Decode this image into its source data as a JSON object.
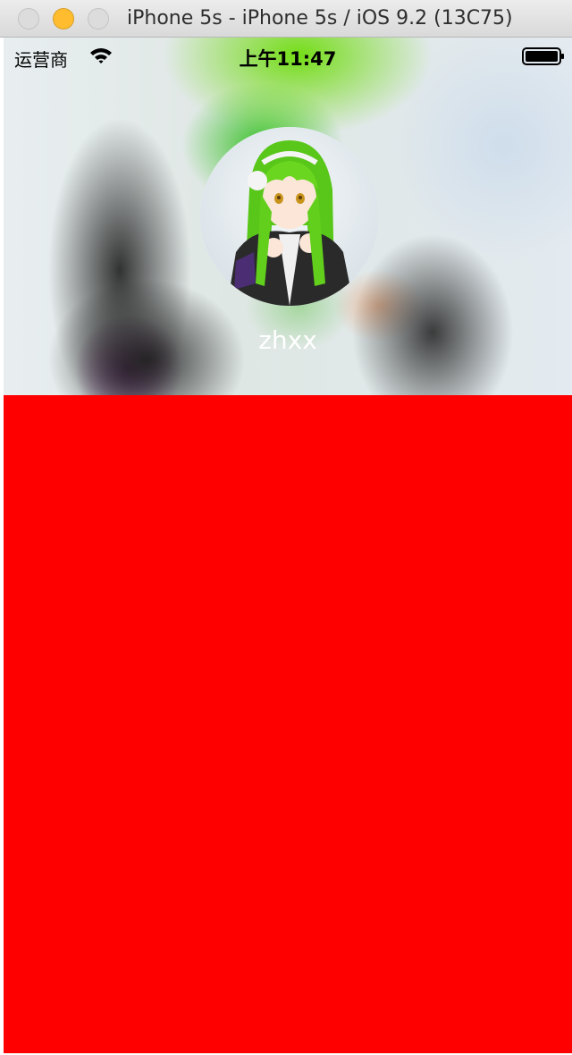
{
  "window": {
    "title": "iPhone 5s - iPhone 5s / iOS 9.2 (13C75)"
  },
  "status_bar": {
    "carrier": "运营商",
    "time": "上午11:47",
    "icons": [
      "wifi-icon",
      "battery-icon"
    ]
  },
  "profile": {
    "username": "zhxx",
    "username_color": "#ffffff"
  },
  "colors": {
    "content_background": "#ff0000",
    "minimize_button": "#febc2e"
  }
}
